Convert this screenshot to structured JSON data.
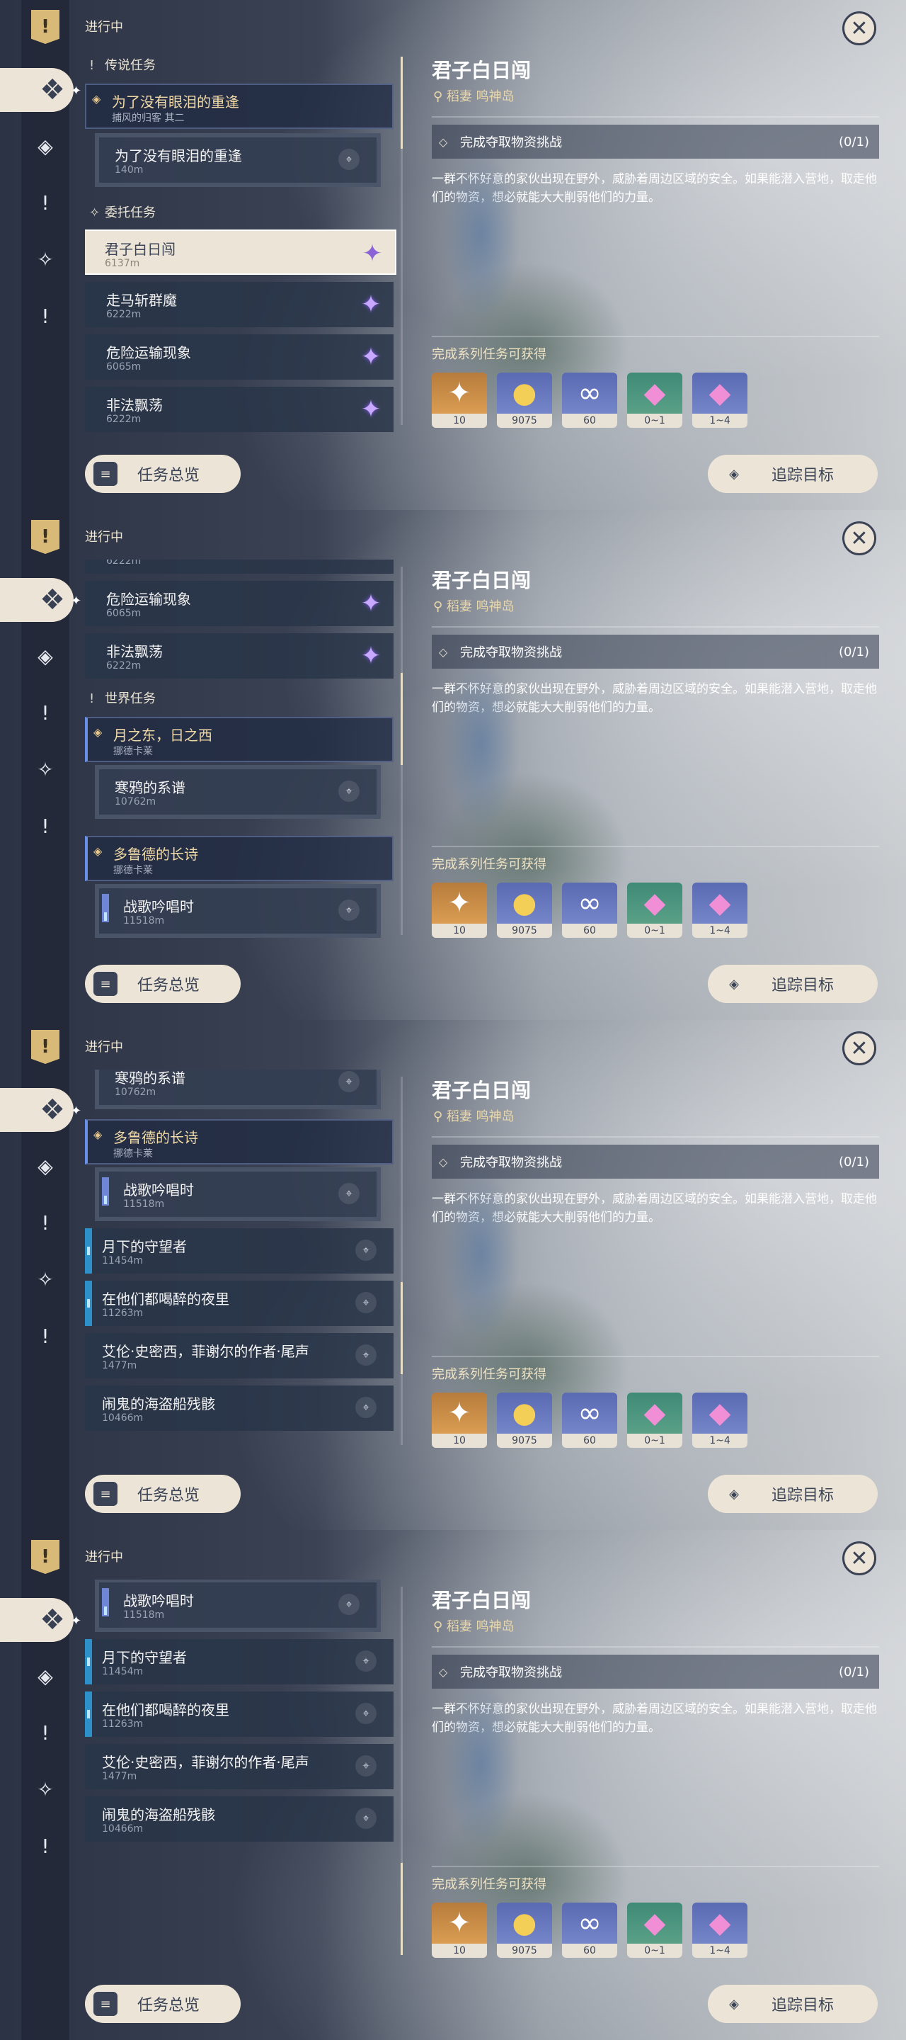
{
  "ui": {
    "ongoing_label": "进行中",
    "overview_button": "任务总览",
    "track_button": "追踪目标",
    "close_icon": "close-icon",
    "alert_icon": "!"
  },
  "detail": {
    "title": "君子白日闯",
    "location": "稻妻 鸣神岛",
    "objective": "完成夺取物资挑战",
    "progress": "(0/1)",
    "description": "一群不怀好意的家伙出现在野外，威胁着周边区域的安全。如果能潜入营地，取走他们的物资，想必就能大大削弱他们的力量。",
    "rewards_title": "完成系列任务可获得",
    "rewards": [
      {
        "icon": "primogem-icon",
        "count": "10"
      },
      {
        "icon": "mora-icon",
        "count": "9075"
      },
      {
        "icon": "fate-icon",
        "count": "60"
      },
      {
        "icon": "crystal-icon",
        "count": "0~1"
      },
      {
        "icon": "crystal-shard-icon",
        "count": "1~4"
      }
    ]
  },
  "quests": {
    "legend_cat": "传说任务",
    "legend_header_title": "为了没有眼泪的重逢",
    "legend_header_sub": "捕风的归客 其二",
    "legend_sub_title": "为了没有眼泪的重逢",
    "legend_sub_dist": "140m",
    "commission_cat": "委托任务",
    "c1_title": "君子白日闯",
    "c1_dist": "6137m",
    "c2_title": "走马斩群魔",
    "c2_dist": "6222m",
    "c3_title": "危险运输现象",
    "c3_dist": "6065m",
    "c4_title": "非法飘荡",
    "c4_dist": "6222m",
    "world_cat": "世界任务",
    "w1_header_title": "月之东，日之西",
    "w1_header_sub": "挪德卡莱",
    "w1_sub_title": "寒鸦的系谱",
    "w1_sub_dist": "10762m",
    "w2_header_title": "多鲁德的长诗",
    "w2_header_sub": "挪德卡莱",
    "w2_sub_title": "战歌吟唱时",
    "w2_sub_dist": "11518m",
    "w3_title": "月下的守望者",
    "w3_dist": "11454m",
    "w4_title": "在他们都喝醉的夜里",
    "w4_dist": "11263m",
    "w5_title": "艾伦·史密西，菲谢尔的作者·尾声",
    "w5_dist": "1477m",
    "w6_title": "闹鬼的海盗船残骸",
    "w6_dist": "10466m"
  }
}
